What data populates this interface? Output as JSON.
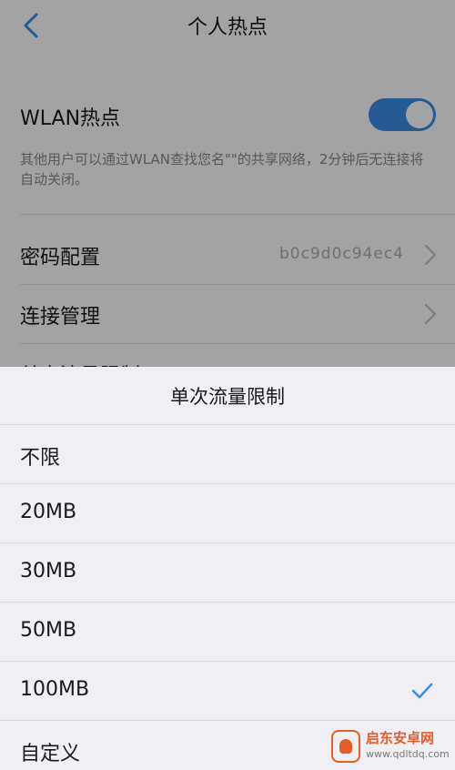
{
  "header": {
    "title": "个人热点"
  },
  "hotspot": {
    "label": "WLAN热点",
    "enabled": true,
    "description": "其他用户可以通过WLAN查找您名\"\"的共享网络，2分钟后无连接将自动关闭。"
  },
  "settings": [
    {
      "label": "密码配置",
      "value": "b0c9d0c94ec4"
    },
    {
      "label": "连接管理",
      "value": ""
    },
    {
      "label": "单次流量限制",
      "value": ""
    }
  ],
  "sheet": {
    "title": "单次流量限制",
    "options": [
      {
        "label": "不限",
        "selected": false
      },
      {
        "label": "20MB",
        "selected": false
      },
      {
        "label": "30MB",
        "selected": false
      },
      {
        "label": "50MB",
        "selected": false
      },
      {
        "label": "100MB",
        "selected": true
      },
      {
        "label": "自定义",
        "selected": false
      }
    ]
  },
  "watermark": {
    "name": "启东安卓网",
    "url": "www.qdltdq.com"
  },
  "colors": {
    "accent": "#3b8ee8",
    "check": "#3b8ee8",
    "overlay": "rgba(0,0,0,0.36)"
  },
  "icons": {
    "back": "chevron-left-icon",
    "row_arrow": "chevron-right-icon",
    "selected": "checkmark-icon"
  }
}
